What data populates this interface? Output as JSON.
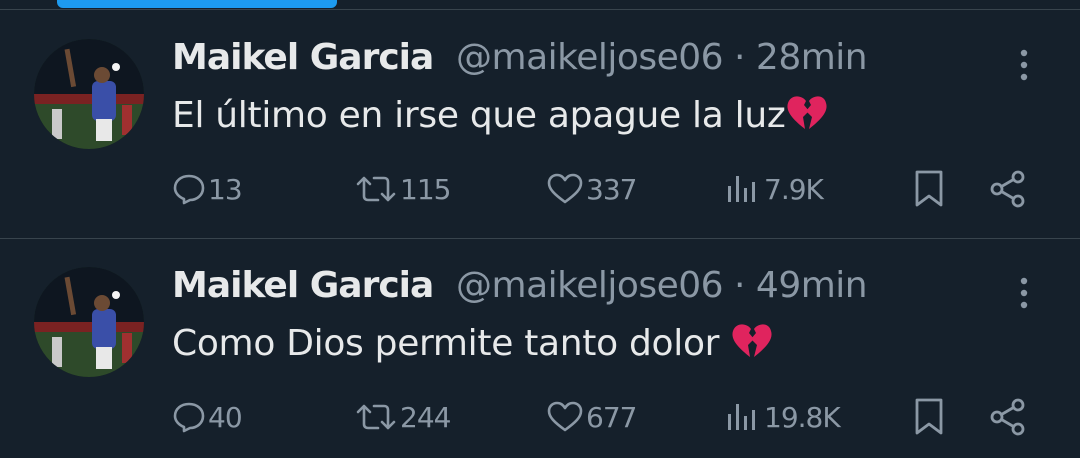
{
  "colors": {
    "background": "#15202b",
    "text_primary": "#e7e9ea",
    "text_secondary": "#8b98a5",
    "divider": "#38444d",
    "accent": "#1d9bf0",
    "broken_heart": "#e0245e"
  },
  "tweets": [
    {
      "author_name": "Maikel Garcia",
      "meta": "@maikeljose06 · 28min",
      "text": "El último en irse que apague la luz",
      "emoji": "broken-heart",
      "replies": "13",
      "reposts": "115",
      "likes": "337",
      "views": "7.9K"
    },
    {
      "author_name": "Maikel Garcia",
      "meta": "@maikeljose06 · 49min",
      "text": "Como Dios permite tanto dolor ",
      "emoji": "broken-heart",
      "replies": "40",
      "reposts": "244",
      "likes": "677",
      "views": "19.8K"
    }
  ]
}
